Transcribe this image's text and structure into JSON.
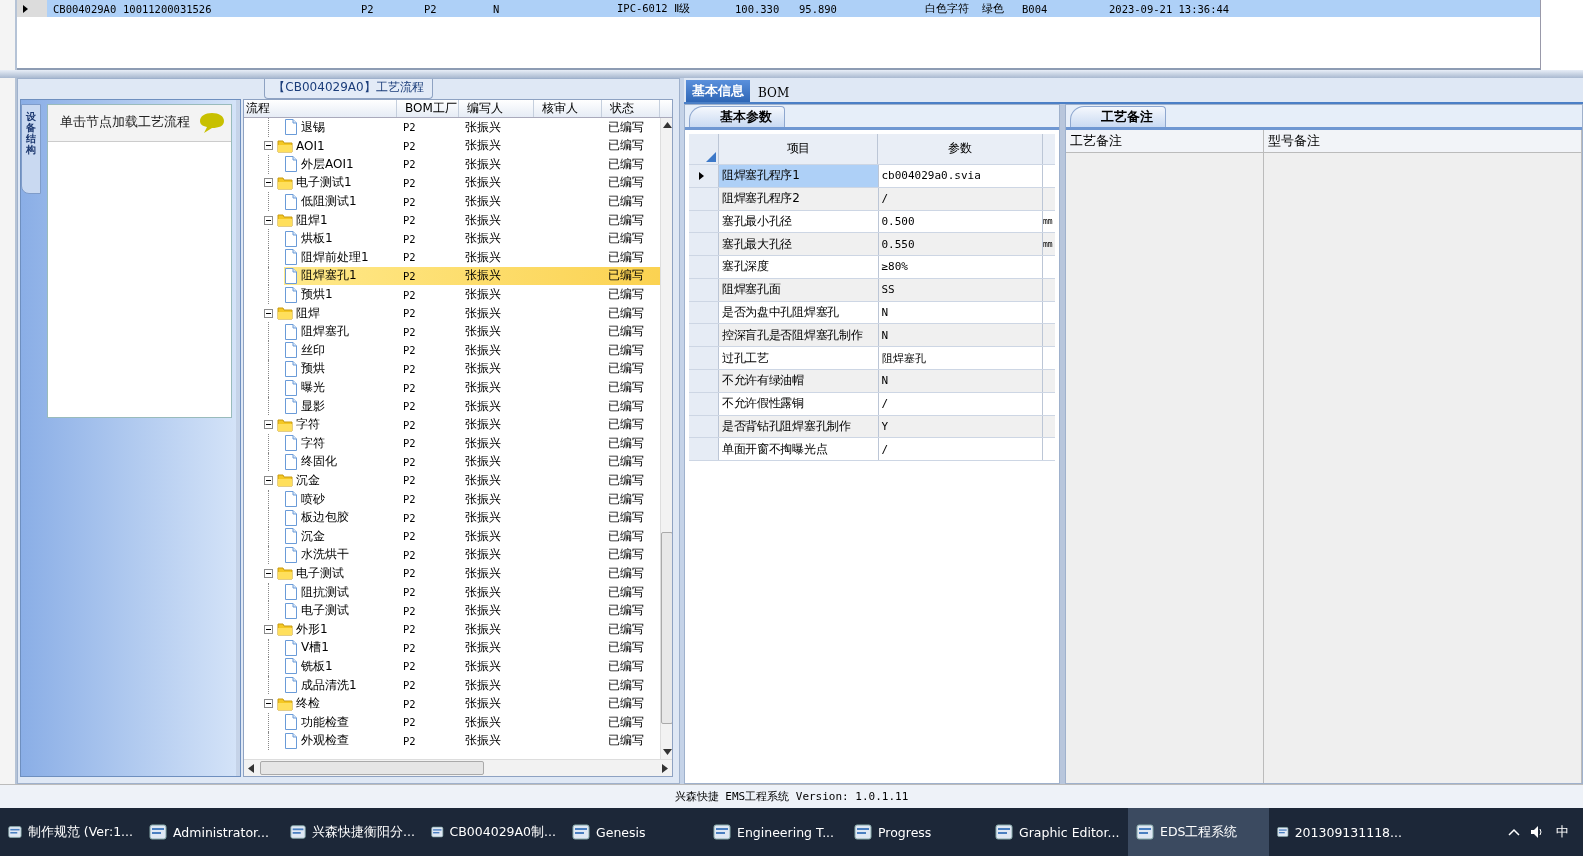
{
  "top_grid": {
    "rows": [
      {
        "selected": true,
        "cells": [
          "CB004029A0",
          "10011200031526",
          "P2",
          "P2",
          "N",
          "IPC-6012 Ⅱ级",
          "100.330",
          "95.890",
          "白色字符",
          "绿色",
          "B004",
          "2023-09-21 13:36:44"
        ]
      }
    ]
  },
  "flow_panel": {
    "title": "【CB004029A0】工艺流程",
    "side": {
      "tab": "设备结构",
      "header": "单击节点加载工艺流程"
    },
    "tree": {
      "columns": [
        "流程",
        "BOM工厂",
        "编写人",
        "核审人",
        "状态"
      ],
      "items": [
        {
          "name": "退锡",
          "kind": "file",
          "factory": "P2",
          "writer": "张振兴",
          "status": "已编写",
          "selected": false
        },
        {
          "name": "AOI1",
          "kind": "folder",
          "expanded": true,
          "factory": "P2",
          "writer": "张振兴",
          "status": "已编写",
          "selected": false,
          "children": [
            {
              "name": "外层AOI1",
              "kind": "file",
              "factory": "P2",
              "writer": "张振兴",
              "status": "已编写",
              "selected": false
            }
          ]
        },
        {
          "name": "电子测试1",
          "kind": "folder",
          "expanded": true,
          "factory": "P2",
          "writer": "张振兴",
          "status": "已编写",
          "selected": false,
          "children": [
            {
              "name": "低阻测试1",
              "kind": "file",
              "factory": "P2",
              "writer": "张振兴",
              "status": "已编写",
              "selected": false
            }
          ]
        },
        {
          "name": "阻焊1",
          "kind": "folder",
          "expanded": true,
          "factory": "P2",
          "writer": "张振兴",
          "status": "已编写",
          "selected": false,
          "children": [
            {
              "name": "烘板1",
              "kind": "file",
              "factory": "P2",
              "writer": "张振兴",
              "status": "已编写",
              "selected": false
            },
            {
              "name": "阻焊前处理1",
              "kind": "file",
              "factory": "P2",
              "writer": "张振兴",
              "status": "已编写",
              "selected": false
            },
            {
              "name": "阻焊塞孔1",
              "kind": "file",
              "factory": "P2",
              "writer": "张振兴",
              "status": "已编写",
              "selected": true
            },
            {
              "name": "预烘1",
              "kind": "file",
              "factory": "P2",
              "writer": "张振兴",
              "status": "已编写",
              "selected": false
            }
          ]
        },
        {
          "name": "阻焊",
          "kind": "folder",
          "expanded": true,
          "factory": "P2",
          "writer": "张振兴",
          "status": "已编写",
          "selected": false,
          "children": [
            {
              "name": "阻焊塞孔",
              "kind": "file",
              "factory": "P2",
              "writer": "张振兴",
              "status": "已编写",
              "selected": false
            },
            {
              "name": "丝印",
              "kind": "file",
              "factory": "P2",
              "writer": "张振兴",
              "status": "已编写",
              "selected": false
            },
            {
              "name": "预烘",
              "kind": "file",
              "factory": "P2",
              "writer": "张振兴",
              "status": "已编写",
              "selected": false
            },
            {
              "name": "曝光",
              "kind": "file",
              "factory": "P2",
              "writer": "张振兴",
              "status": "已编写",
              "selected": false
            },
            {
              "name": "显影",
              "kind": "file",
              "factory": "P2",
              "writer": "张振兴",
              "status": "已编写",
              "selected": false
            }
          ]
        },
        {
          "name": "字符",
          "kind": "folder",
          "expanded": true,
          "factory": "P2",
          "writer": "张振兴",
          "status": "已编写",
          "selected": false,
          "children": [
            {
              "name": "字符",
              "kind": "file",
              "factory": "P2",
              "writer": "张振兴",
              "status": "已编写",
              "selected": false
            },
            {
              "name": "终固化",
              "kind": "file",
              "factory": "P2",
              "writer": "张振兴",
              "status": "已编写",
              "selected": false
            }
          ]
        },
        {
          "name": "沉金",
          "kind": "folder",
          "expanded": true,
          "factory": "P2",
          "writer": "张振兴",
          "status": "已编写",
          "selected": false,
          "children": [
            {
              "name": "喷砂",
              "kind": "file",
              "factory": "P2",
              "writer": "张振兴",
              "status": "已编写",
              "selected": false
            },
            {
              "name": "板边包胶",
              "kind": "file",
              "factory": "P2",
              "writer": "张振兴",
              "status": "已编写",
              "selected": false
            },
            {
              "name": "沉金",
              "kind": "file",
              "factory": "P2",
              "writer": "张振兴",
              "status": "已编写",
              "selected": false
            },
            {
              "name": "水洗烘干",
              "kind": "file",
              "factory": "P2",
              "writer": "张振兴",
              "status": "已编写",
              "selected": false
            }
          ]
        },
        {
          "name": "电子测试",
          "kind": "folder",
          "expanded": true,
          "factory": "P2",
          "writer": "张振兴",
          "status": "已编写",
          "selected": false,
          "children": [
            {
              "name": "阻抗测试",
              "kind": "file",
              "factory": "P2",
              "writer": "张振兴",
              "status": "已编写",
              "selected": false
            },
            {
              "name": "电子测试",
              "kind": "file",
              "factory": "P2",
              "writer": "张振兴",
              "status": "已编写",
              "selected": false
            }
          ]
        },
        {
          "name": "外形1",
          "kind": "folder",
          "expanded": true,
          "factory": "P2",
          "writer": "张振兴",
          "status": "已编写",
          "selected": false,
          "children": [
            {
              "name": "V槽1",
              "kind": "file",
              "factory": "P2",
              "writer": "张振兴",
              "status": "已编写",
              "selected": false
            },
            {
              "name": "铣板1",
              "kind": "file",
              "factory": "P2",
              "writer": "张振兴",
              "status": "已编写",
              "selected": false
            },
            {
              "name": "成品清洗1",
              "kind": "file",
              "factory": "P2",
              "writer": "张振兴",
              "status": "已编写",
              "selected": false
            }
          ]
        },
        {
          "name": "终检",
          "kind": "folder",
          "expanded": true,
          "factory": "P2",
          "writer": "张振兴",
          "status": "已编写",
          "selected": false,
          "children": [
            {
              "name": "功能检查",
              "kind": "file",
              "factory": "P2",
              "writer": "张振兴",
              "status": "已编写",
              "selected": false
            },
            {
              "name": "外观检查",
              "kind": "file",
              "factory": "P2",
              "writer": "张振兴",
              "status": "已编写",
              "selected": false
            }
          ]
        }
      ]
    }
  },
  "info_panel": {
    "tabs": [
      {
        "label": "基本信息",
        "selected": true
      },
      {
        "label": "BOM",
        "selected": false
      }
    ],
    "params": {
      "tab": "基本参数",
      "columns": [
        "项目",
        "参数"
      ],
      "rows": [
        {
          "item": "阻焊塞孔程序1",
          "value": "cb004029a0.svia",
          "selected": true
        },
        {
          "item": "阻焊塞孔程序2",
          "value": "/",
          "selected": false
        },
        {
          "item": "塞孔最小孔径",
          "value": "0.500",
          "unit": "mm",
          "selected": false
        },
        {
          "item": "塞孔最大孔径",
          "value": "0.550",
          "unit": "mm",
          "selected": false
        },
        {
          "item": "塞孔深度",
          "value": "≥80%",
          "selected": false
        },
        {
          "item": "阻焊塞孔面",
          "value": "SS",
          "selected": false
        },
        {
          "item": "是否为盘中孔阻焊塞孔",
          "value": "N",
          "selected": false
        },
        {
          "item": "控深盲孔是否阻焊塞孔制作",
          "value": "N",
          "selected": false
        },
        {
          "item": "过孔工艺",
          "value": "阻焊塞孔",
          "selected": false
        },
        {
          "item": "不允许有绿油帽",
          "value": "N",
          "selected": false
        },
        {
          "item": "不允许假性露铜",
          "value": "/",
          "selected": false
        },
        {
          "item": "是否背钻孔阻焊塞孔制作",
          "value": "Y",
          "selected": false
        },
        {
          "item": "单面开窗不掏曝光点",
          "value": "/",
          "selected": false
        }
      ]
    },
    "notes": {
      "tab": "工艺备注",
      "columns": [
        "工艺备注",
        "型号备注"
      ]
    }
  },
  "status_bar": "兴森快捷 EMS工程系统 Version: 1.0.1.11",
  "taskbar": {
    "items": [
      {
        "label": "制作规范 (Ver:1...",
        "selected": false
      },
      {
        "label": "Administrator...",
        "selected": false
      },
      {
        "label": "兴森快捷衡阳分...",
        "selected": false
      },
      {
        "label": "CB004029A0制...",
        "selected": false
      },
      {
        "label": "Genesis",
        "selected": false
      },
      {
        "label": "Engineering T...",
        "selected": false
      },
      {
        "label": "Progress",
        "selected": false
      },
      {
        "label": "Graphic Editor...",
        "selected": false
      },
      {
        "label": "EDS工程系统",
        "selected": true
      },
      {
        "label": "201309131118...",
        "selected": false
      }
    ],
    "ime": "中"
  }
}
